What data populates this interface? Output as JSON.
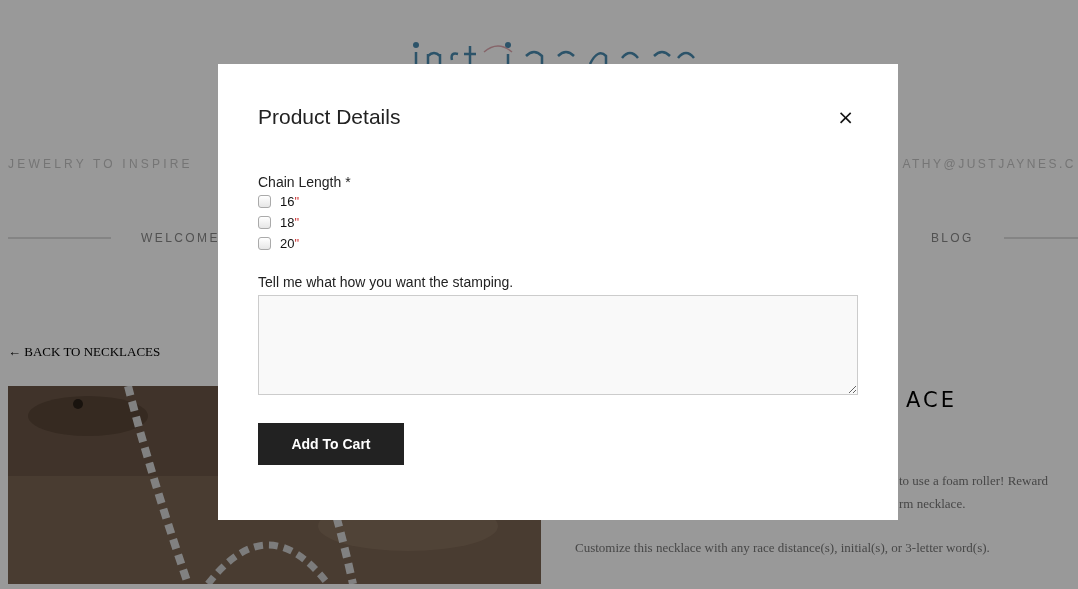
{
  "page": {
    "tagline": "JEWELRY TO INSPIRE",
    "email": "ATHY@JUSTJAYNES.C",
    "nav": [
      {
        "label": "WELCOME"
      },
      {
        "label": "BLOG"
      }
    ],
    "back_link": "← BACK TO NECKLACES",
    "product": {
      "title": "ACE",
      "description_lines": [
        "to use a foam roller! Reward",
        "rm necklace."
      ],
      "note": "Customize this necklace with any race distance(s), initial(s), or 3-letter word(s)."
    }
  },
  "modal": {
    "title": "Product Details",
    "close": "×",
    "chain_length": {
      "label": "Chain Length *",
      "options": [
        {
          "value": "16",
          "mark": "\"",
          "checked": false
        },
        {
          "value": "18",
          "mark": "\"",
          "checked": false
        },
        {
          "value": "20",
          "mark": "\"",
          "checked": false
        }
      ]
    },
    "stamping": {
      "label": "Tell me what how you want the stamping."
    },
    "button": "Add To Cart"
  }
}
